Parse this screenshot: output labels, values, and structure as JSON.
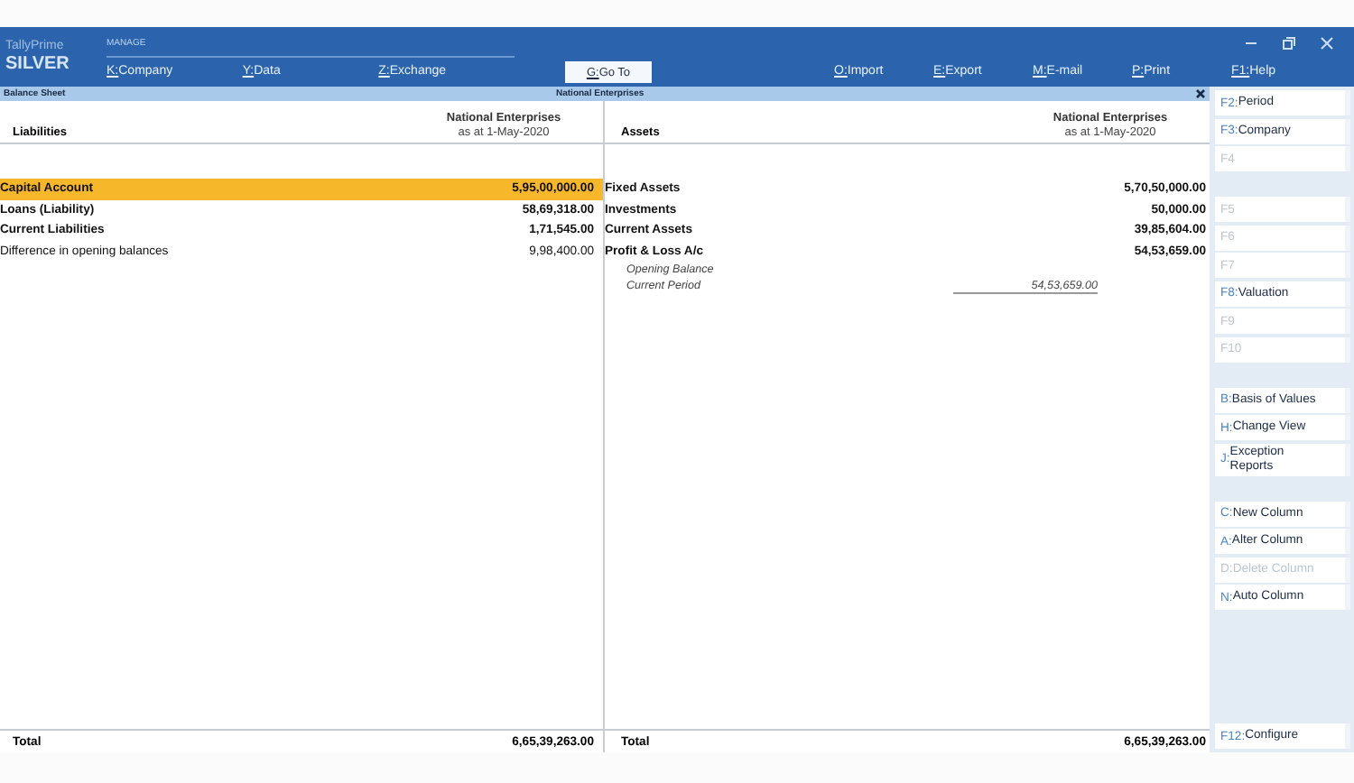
{
  "header": {
    "product": "TallyPrime",
    "edition": "SILVER",
    "menu_label": "MANAGE",
    "menus": [
      {
        "key": "K:",
        "label": "Company"
      },
      {
        "key": "Y:",
        "label": "Data"
      },
      {
        "key": "Z:",
        "label": "Exchange"
      }
    ],
    "goto": {
      "key": "G:",
      "label": "Go To"
    },
    "actions": [
      {
        "key": "O:",
        "label": "Import"
      },
      {
        "key": "E:",
        "label": "Export"
      },
      {
        "key": "M:",
        "label": "E-mail"
      },
      {
        "key": "P:",
        "label": "Print"
      },
      {
        "key": "F1:",
        "label": "Help"
      }
    ]
  },
  "report": {
    "title": "Balance Sheet",
    "company": "National Enterprises"
  },
  "liabilities": {
    "heading": "Liabilities",
    "company": "National Enterprises",
    "date": "as at 1-May-2020",
    "rows": [
      {
        "name": "Capital Account",
        "amount": "5,95,00,000.00",
        "kind": "group",
        "selected": true
      },
      {
        "name": "Loans (Liability)",
        "amount": "58,69,318.00",
        "kind": "group",
        "selected": false
      },
      {
        "name": "Current Liabilities",
        "amount": "1,71,545.00",
        "kind": "group",
        "selected": false
      },
      {
        "name": "Difference in opening balances",
        "amount": "9,98,400.00",
        "kind": "ledger",
        "selected": false
      }
    ],
    "total_label": "Total",
    "total": "6,65,39,263.00"
  },
  "assets": {
    "heading": "Assets",
    "company": "National Enterprises",
    "date": "as at 1-May-2020",
    "rows": [
      {
        "name": "Fixed Assets",
        "amount": "5,70,50,000.00",
        "kind": "group",
        "selected": false
      },
      {
        "name": "Investments",
        "amount": "50,000.00",
        "kind": "group",
        "selected": false
      },
      {
        "name": "Current Assets",
        "amount": "39,85,604.00",
        "kind": "group",
        "selected": false
      },
      {
        "name": "Profit & Loss A/c",
        "amount": "54,53,659.00",
        "kind": "group",
        "selected": false
      },
      {
        "name": "Opening Balance",
        "kind": "detail",
        "selected": false
      },
      {
        "name": "Current Period",
        "sub_amount": "54,53,659.00",
        "kind": "detail",
        "selected": false
      }
    ],
    "total_label": "Total",
    "total": "6,65,39,263.00"
  },
  "sidebar": {
    "groups": [
      {
        "items": [
          {
            "key": "F2:",
            "label": "Period",
            "disabled": false
          },
          {
            "key": "F3:",
            "label": "Company",
            "disabled": false
          },
          {
            "key": "F4",
            "disabled": true
          }
        ]
      },
      {
        "items": [
          {
            "key": "F5",
            "disabled": true
          },
          {
            "key": "F6",
            "disabled": true
          },
          {
            "key": "F7",
            "disabled": true
          },
          {
            "key": "F8:",
            "label": "Valuation",
            "disabled": false
          },
          {
            "key": "F9",
            "disabled": true
          },
          {
            "key": "F10",
            "disabled": true
          }
        ]
      },
      {
        "items": [
          {
            "key": "B:",
            "label": "Basis of Values",
            "disabled": false
          },
          {
            "key": "H:",
            "label": "Change View",
            "disabled": false
          },
          {
            "key": "J:",
            "label": "Exception\nReports",
            "disabled": false
          }
        ]
      },
      {
        "items": [
          {
            "key": "C:",
            "label": "New Column",
            "disabled": false
          },
          {
            "key": "A:",
            "label": "Alter Column",
            "disabled": false
          },
          {
            "key": "D:",
            "label": "Delete Column",
            "disabled": true
          },
          {
            "key": "N:",
            "label": "Auto Column",
            "disabled": false
          }
        ]
      }
    ],
    "bottom": {
      "key": "F12:",
      "label": "Configure",
      "disabled": false
    }
  }
}
